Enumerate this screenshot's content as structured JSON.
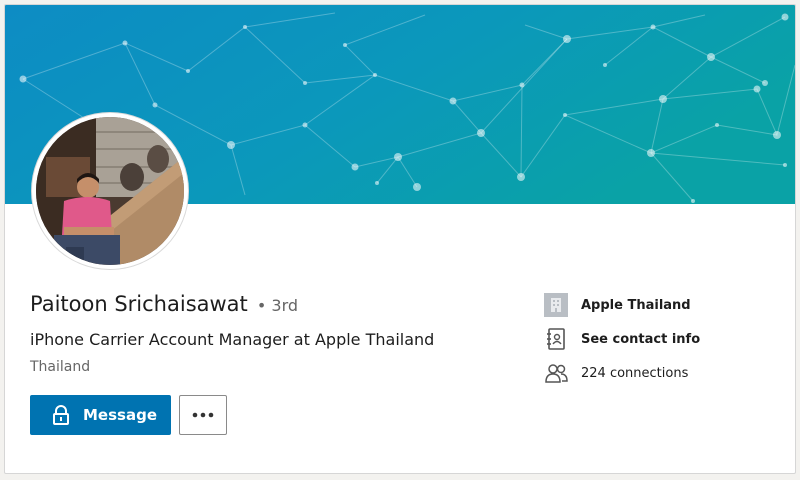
{
  "profile": {
    "name": "Paitoon Srichaisawat",
    "degree": "• 3rd",
    "headline": "iPhone Carrier Account Manager at Apple Thailand",
    "location": "Thailand"
  },
  "actions": {
    "message_label": "Message",
    "more_icon": "more-horizontal-icon",
    "lock_icon": "lock-icon"
  },
  "sidebar": {
    "items": [
      {
        "label": "Apple Thailand",
        "icon": "company-logo-icon"
      },
      {
        "label": "See contact info",
        "icon": "contact-card-icon"
      },
      {
        "label": "224 connections",
        "icon": "people-icon"
      }
    ]
  },
  "colors": {
    "accent": "#0073b1",
    "banner_left": "#0e8fc6",
    "banner_right": "#0aa0a8",
    "text_primary": "#1d1d1d",
    "text_secondary": "#666666"
  }
}
